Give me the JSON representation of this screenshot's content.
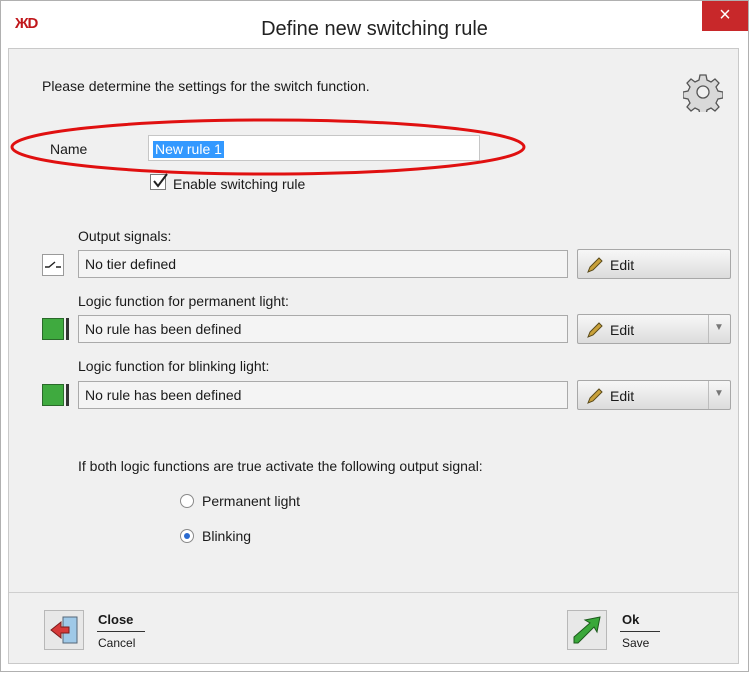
{
  "window": {
    "title": "Define new switching rule",
    "app_icon_glyph": "ЖD",
    "close_glyph": "×",
    "accent_close": "#c8282a"
  },
  "intro": "Please determine the settings for the switch function.",
  "name": {
    "label": "Name",
    "value": "New rule 1"
  },
  "enable": {
    "label": "Enable switching rule",
    "checked": true
  },
  "output": {
    "label": "Output signals:",
    "value": "No tier defined",
    "button": "Edit",
    "icon": "switch-signal-icon"
  },
  "permanent": {
    "label": "Logic function for permanent light:",
    "value": "No rule has been defined",
    "button": "Edit",
    "icon": "green-light-icon"
  },
  "blinking": {
    "label": "Logic function for blinking light:",
    "value": "No rule has been defined",
    "button": "Edit",
    "icon": "green-light-icon"
  },
  "both_text": "If both logic functions are true activate the following output signal:",
  "options": [
    {
      "label": "Permanent light",
      "selected": false
    },
    {
      "label": "Blinking",
      "selected": true
    }
  ],
  "footer": {
    "close": {
      "top": "Close",
      "bottom": "Cancel"
    },
    "ok": {
      "top": "Ok",
      "bottom": "Save"
    }
  },
  "colors": {
    "selection": "#3399ff",
    "indicator_green": "#3faa3f",
    "highlight_ellipse": "#e01010"
  }
}
